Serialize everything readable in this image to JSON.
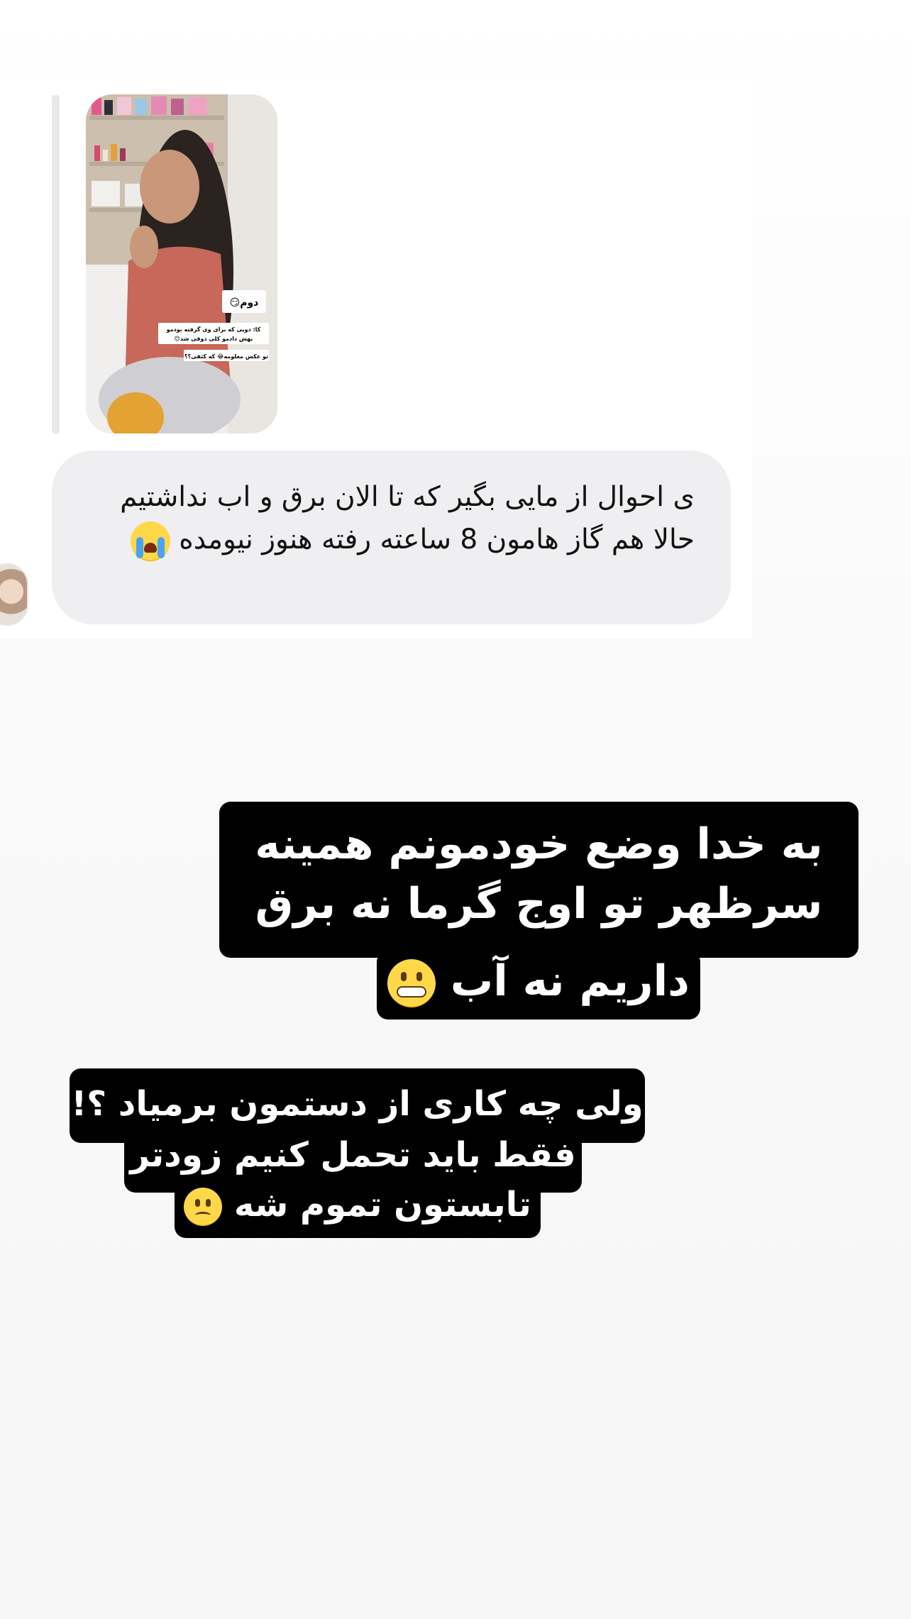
{
  "chat": {
    "message_text": "ی احوال از مایی بگیر  که تا الان برق و اب نداشتیم حالا هم گاز هامون 8 ساعته رفته هنوز نیومده",
    "message_emoji": "loudly-crying-face-emoji",
    "photo": {
      "caption_title": "دوم😏",
      "caption_line1": "کا: دویی که برای وی گرفته بودمو",
      "caption_line2": "بهش دادمو کلی ذوقی شد😊",
      "caption_line3": "تو عکس معلومه😂 که کثقی؟؟"
    }
  },
  "story_text": {
    "block1": {
      "line1": "به خدا وضع خودمونم همینه",
      "line2": "سرظهر تو اوج گرما نه برق",
      "line3": "داریم نه آب",
      "emoji": "grimacing-face-emoji"
    },
    "block2": {
      "line1": "ولی چه کاری از دستمون برمیاد ؟!",
      "line2": "فقط باید تحمل کنیم زودتر",
      "line3": "تابستون تموم شه",
      "emoji": "slightly-frowning-face-emoji"
    }
  },
  "colors": {
    "bubble_bg": "#efeff1",
    "overlay_bg": "#000000",
    "overlay_text": "#ffffff"
  }
}
